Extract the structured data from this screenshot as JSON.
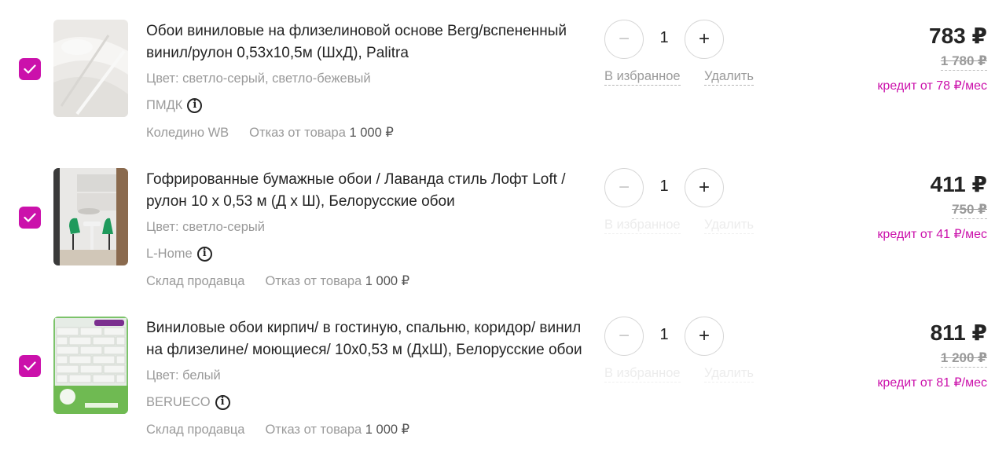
{
  "accent_color": "#cb11ab",
  "items": [
    {
      "title": "Обои виниловые на флизелиновой основе Berg/вспененный винил/рулон 0,53х10,5м (ШхД), Palitra",
      "color_text": "Цвет: светло-серый, светло-бежевый",
      "seller": "ПМДК",
      "warehouse": "Коледино WB",
      "refuse_label": "Отказ от товара",
      "refuse_amount": "1 000 ₽",
      "quantity": "1",
      "fav_label": "В избранное",
      "delete_label": "Удалить",
      "price": "783 ₽",
      "old_price": "1 780 ₽",
      "credit": "кредит от 78 ₽/мес",
      "checked": true
    },
    {
      "title": "Гофрированные бумажные обои / Лаванда стиль Лофт Loft / рулон 10 х 0,53 м (Д х Ш), Белорусские обои",
      "color_text": "Цвет: светло-серый",
      "seller": "L-Home",
      "warehouse": "Склад продавца",
      "refuse_label": "Отказ от товара",
      "refuse_amount": "1 000 ₽",
      "quantity": "1",
      "fav_label": "В избранное",
      "delete_label": "Удалить",
      "price": "411 ₽",
      "old_price": "750 ₽",
      "credit": "кредит от 41 ₽/мес",
      "checked": true
    },
    {
      "title": "Виниловые обои кирпич/ в гостиную, спальню, коридор/ винил на флизелине/ моющиеся/ 10х0,53 м (ДхШ), Белорусские обои",
      "color_text": "Цвет: белый",
      "seller": "BERUECO",
      "warehouse": "Склад продавца",
      "refuse_label": "Отказ от товара",
      "refuse_amount": "1 000 ₽",
      "quantity": "1",
      "fav_label": "В избранное",
      "delete_label": "Удалить",
      "price": "811 ₽",
      "old_price": "1 200 ₽",
      "credit": "кредит от 81 ₽/мес",
      "checked": true
    }
  ]
}
